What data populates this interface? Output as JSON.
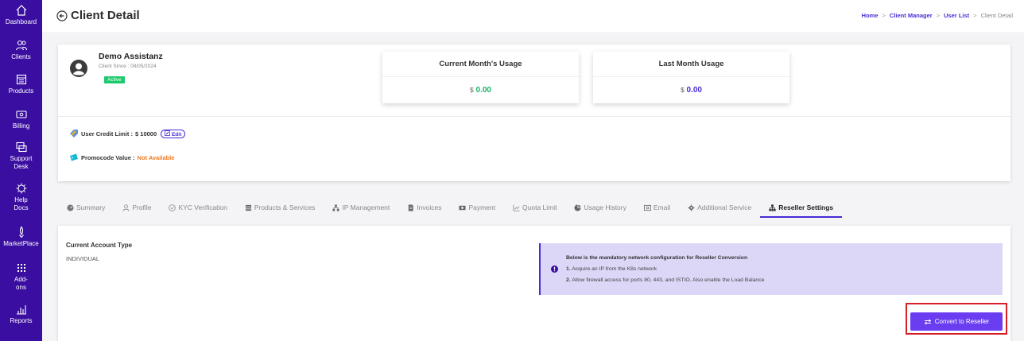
{
  "sidebar": {
    "items": [
      {
        "label": "Dashboard",
        "icon": "home-icon"
      },
      {
        "label": "Clients",
        "icon": "users-icon"
      },
      {
        "label": "Products",
        "icon": "products-icon"
      },
      {
        "label": "Billing",
        "icon": "billing-icon"
      },
      {
        "label": "Support Desk",
        "icon": "support-icon"
      },
      {
        "label": "Help Docs",
        "icon": "help-icon"
      },
      {
        "label": "MarketPlace",
        "icon": "marketplace-icon"
      },
      {
        "label": "Add-ons",
        "icon": "addons-icon"
      },
      {
        "label": "Reports",
        "icon": "reports-icon"
      }
    ]
  },
  "header": {
    "title": "Client Detail",
    "breadcrumb": [
      {
        "label": "Home"
      },
      {
        "label": "Client Manager"
      },
      {
        "label": "User List"
      },
      {
        "label": "Client Detail"
      }
    ],
    "separator": ">"
  },
  "client": {
    "name": "Demo Assistanz",
    "since": "Client Since : 08/05/2024",
    "status": "Active",
    "current_usage_title": "Current Month's Usage",
    "current_usage_currency": "$",
    "current_usage_value": "0.00",
    "last_usage_title": "Last Month Usage",
    "last_usage_currency": "$",
    "last_usage_value": "0.00",
    "credit_label": "User Credit Limit :",
    "credit_value": "$ 10000",
    "edit_label": "Edit",
    "promo_label": "Promocode Value :",
    "promo_value": "Not Available"
  },
  "tabs": [
    {
      "label": "Summary",
      "icon": "summary-icon"
    },
    {
      "label": "Profile",
      "icon": "profile-icon"
    },
    {
      "label": "KYC Verification",
      "icon": "kyc-icon"
    },
    {
      "label": "Products & Services",
      "icon": "products-services-icon"
    },
    {
      "label": "IP Management",
      "icon": "ip-icon"
    },
    {
      "label": "Invoices",
      "icon": "invoice-icon"
    },
    {
      "label": "Payment",
      "icon": "payment-icon"
    },
    {
      "label": "Quota Limit",
      "icon": "quota-icon"
    },
    {
      "label": "Usage History",
      "icon": "usage-icon"
    },
    {
      "label": "Email",
      "icon": "email-icon"
    },
    {
      "label": "Additional Service",
      "icon": "additional-service-icon"
    },
    {
      "label": "Reseller Settings",
      "icon": "reseller-icon"
    }
  ],
  "reseller": {
    "account_type_label": "Current Account Type",
    "account_type_value": "INDIVIDUAL",
    "info_title": "Below is the mandatory network configuration for Reseller Conversion",
    "info_lines": [
      {
        "num": "1.",
        "text": "Acquire an IP from the K8s network"
      },
      {
        "num": "2.",
        "text": "Allow firewall access for ports 80, 443, and ISTIO. Also enable the Load Balance"
      }
    ],
    "convert_label": "Convert to Reseller"
  },
  "colors": {
    "sidebar_bg": "#3a0ea0",
    "accent": "#4a2bd6",
    "button": "#6a3df0",
    "active_badge": "#1ec96b",
    "promo": "#f07a22",
    "highlight_outline": "#d61f26"
  }
}
